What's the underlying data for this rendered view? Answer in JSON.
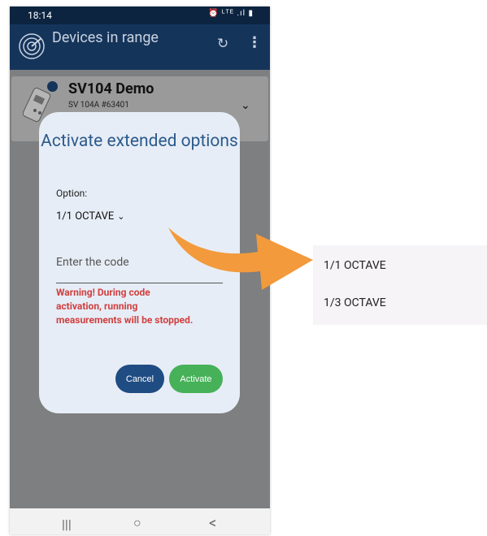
{
  "status": {
    "time": "18:14",
    "icons": "⏰ ᴸᵀᴱ .ıl ▮"
  },
  "appbar": {
    "title": "Devices in range",
    "refresh_icon": "↻",
    "more_icon": "⋮"
  },
  "device": {
    "name": "SV104 Demo",
    "serial": "SV 104A #63401",
    "chevron": "⌄"
  },
  "dialog": {
    "title": "Activate extended options",
    "option_label": "Option:",
    "option_value": "1/1 OCTAVE",
    "code_placeholder": "Enter the code",
    "warning": "Warning! During code activation, running measurements will be stopped.",
    "cancel_label": "Cancel",
    "activate_label": "Activate"
  },
  "navbar": {
    "recents": "|||",
    "home": "○",
    "back": "<"
  },
  "dropdown": {
    "options": [
      "1/1 OCTAVE",
      "1/3 OCTAVE"
    ]
  },
  "colors": {
    "accent": "#15345a",
    "arrow": "#f29a3c",
    "activate": "#46b158",
    "cancel": "#1f4c83",
    "warning": "#d04040"
  }
}
